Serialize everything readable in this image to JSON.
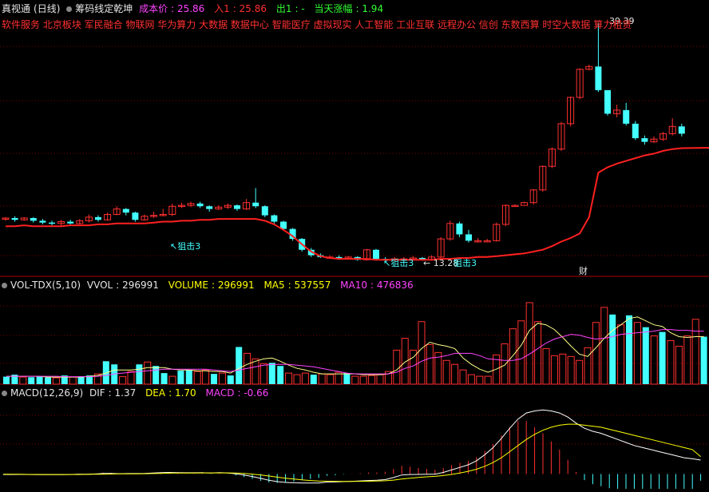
{
  "header": {
    "app": "真视通",
    "period": "(日线)",
    "indicator": "筹码线定乾坤",
    "cost_label": "成本价",
    "cost_value": "25.86",
    "in_label": "入1",
    "in_value": "25.86",
    "out_label": "出1",
    "out_value": "-",
    "chg_label": "当天涨幅",
    "chg_value": "1.94"
  },
  "concepts": "软件服务 北京板块 军民融合 物联网 华为算力 大数据 数据中心 智能医疗 虚拟现实 人工智能 工业互联 远程办公 信创 东数西算 时空大数据 算力租赁",
  "price_annotations": {
    "high": "39.39",
    "low": "13.28",
    "attack": "狙击3",
    "cai": "财"
  },
  "vol_header": {
    "name": "VOL-TDX(5,10)",
    "vvol_label": "VVOL",
    "vvol": "296991",
    "volume_label": "VOLUME",
    "volume": "296991",
    "ma5_label": "MA5",
    "ma5": "537557",
    "ma10_label": "MA10",
    "ma10": "476836"
  },
  "macd_header": {
    "name": "MACD(12,26,9)",
    "dif_label": "DIF",
    "dif": "1.37",
    "dea_label": "DEA",
    "dea": "1.70",
    "macd_label": "MACD",
    "macd": "-0.66"
  },
  "colors": {
    "up": "#ff3030",
    "down": "#44ffff",
    "cost_line": "#ff2020",
    "vol_ma5": "#ffff88",
    "vol_ma10": "#ff44ff",
    "dif": "#ffffff",
    "dea": "#ffff00",
    "grid": "#7a0000"
  },
  "chart_data": [
    {
      "type": "candlestick",
      "title": "筹码线定乾坤",
      "ylim": [
        12,
        40
      ],
      "candles": [
        [
          17.8,
          17.9,
          18.0,
          17.6
        ],
        [
          17.9,
          17.7,
          18.1,
          17.5
        ],
        [
          17.7,
          17.9,
          18.0,
          17.6
        ],
        [
          17.9,
          17.6,
          18.0,
          17.4
        ],
        [
          17.6,
          17.4,
          17.8,
          17.2
        ],
        [
          17.4,
          17.3,
          17.6,
          17.1
        ],
        [
          17.3,
          17.5,
          17.7,
          17.1
        ],
        [
          17.5,
          17.3,
          17.7,
          17.2
        ],
        [
          17.3,
          17.6,
          17.8,
          17.2
        ],
        [
          17.6,
          18.0,
          18.3,
          17.4
        ],
        [
          18.0,
          17.7,
          18.2,
          17.5
        ],
        [
          17.7,
          18.3,
          18.5,
          17.6
        ],
        [
          18.3,
          18.9,
          19.2,
          18.2
        ],
        [
          18.9,
          18.5,
          19.0,
          18.2
        ],
        [
          18.5,
          17.7,
          18.6,
          17.5
        ],
        [
          17.7,
          18.1,
          18.3,
          17.6
        ],
        [
          18.1,
          18.2,
          18.6,
          17.9
        ],
        [
          18.2,
          18.3,
          18.9,
          18.1
        ],
        [
          18.3,
          19.2,
          19.5,
          18.1
        ],
        [
          19.2,
          19.3,
          19.6,
          19.0
        ],
        [
          19.3,
          19.5,
          19.7,
          19.1
        ],
        [
          19.5,
          19.2,
          19.7,
          19.0
        ],
        [
          19.2,
          18.9,
          19.3,
          18.6
        ],
        [
          18.9,
          19.1,
          19.3,
          18.8
        ],
        [
          19.1,
          19.3,
          19.5,
          18.9
        ],
        [
          19.3,
          18.9,
          19.4,
          18.7
        ],
        [
          18.9,
          19.6,
          20.0,
          18.8
        ],
        [
          19.6,
          19.2,
          21.2,
          19.0
        ],
        [
          19.2,
          18.2,
          19.3,
          18.0
        ],
        [
          18.2,
          17.5,
          18.3,
          17.3
        ],
        [
          17.5,
          16.7,
          17.6,
          16.5
        ],
        [
          16.7,
          15.6,
          16.8,
          15.4
        ],
        [
          15.6,
          14.4,
          15.7,
          14.2
        ],
        [
          14.4,
          13.8,
          14.6,
          13.6
        ],
        [
          13.8,
          13.6,
          14.0,
          13.5
        ],
        [
          13.6,
          13.6,
          13.8,
          13.4
        ],
        [
          13.6,
          13.5,
          13.8,
          13.3
        ],
        [
          13.5,
          13.6,
          13.7,
          13.4
        ],
        [
          13.6,
          13.3,
          13.7,
          13.2
        ],
        [
          13.3,
          14.4,
          14.5,
          13.2
        ],
        [
          14.4,
          13.4,
          14.5,
          13.3
        ],
        [
          13.4,
          13.3,
          13.6,
          13.2
        ],
        [
          13.3,
          13.4,
          13.6,
          13.2
        ],
        [
          13.4,
          13.4,
          13.6,
          13.3
        ],
        [
          13.4,
          13.5,
          13.7,
          13.3
        ],
        [
          13.5,
          13.3,
          13.6,
          13.2
        ],
        [
          13.3,
          13.6,
          13.8,
          13.2
        ],
        [
          13.6,
          15.6,
          15.8,
          13.5
        ],
        [
          15.6,
          17.3,
          17.6,
          15.4
        ],
        [
          17.3,
          16.1,
          17.5,
          15.8
        ],
        [
          16.1,
          15.4,
          16.6,
          15.2
        ],
        [
          15.4,
          15.4,
          15.7,
          15.2
        ],
        [
          15.4,
          15.4,
          15.6,
          15.3
        ],
        [
          15.4,
          17.2,
          17.4,
          15.3
        ],
        [
          17.2,
          19.3,
          19.4,
          17.0
        ],
        [
          19.3,
          19.3,
          19.4,
          19.2
        ],
        [
          19.3,
          19.6,
          19.7,
          19.5
        ],
        [
          19.6,
          21.0,
          21.1,
          19.4
        ],
        [
          21.0,
          23.6,
          23.7,
          20.8
        ],
        [
          23.6,
          25.5,
          25.7,
          23.4
        ],
        [
          25.5,
          28.3,
          28.5,
          25.3
        ],
        [
          28.3,
          31.2,
          31.3,
          28.0
        ],
        [
          31.2,
          34.3,
          34.4,
          31.0
        ],
        [
          34.3,
          34.6,
          34.8,
          34.2
        ],
        [
          34.6,
          32.0,
          39.39,
          31.8
        ],
        [
          32.0,
          29.4,
          30.9,
          29.2
        ],
        [
          29.4,
          29.8,
          30.4,
          29.0
        ],
        [
          29.8,
          28.3,
          30.6,
          28.1
        ],
        [
          28.3,
          26.7,
          28.6,
          26.5
        ],
        [
          26.7,
          26.3,
          27.0,
          26.0
        ],
        [
          26.3,
          26.6,
          26.9,
          26.2
        ],
        [
          26.6,
          27.2,
          27.4,
          26.4
        ],
        [
          27.2,
          28.0,
          28.9,
          27.0
        ],
        [
          28.0,
          27.2,
          28.3,
          26.9
        ]
      ],
      "cost_line": [
        17.0,
        17.0,
        17.1,
        17.0,
        17.0,
        17.0,
        17.0,
        17.1,
        17.1,
        17.1,
        17.2,
        17.2,
        17.3,
        17.3,
        17.3,
        17.3,
        17.4,
        17.5,
        17.5,
        17.6,
        17.6,
        17.7,
        17.7,
        17.8,
        17.8,
        17.8,
        17.8,
        17.8,
        17.6,
        17.2,
        16.6,
        15.9,
        15.0,
        14.2,
        13.7,
        13.5,
        13.4,
        13.4,
        13.4,
        13.4,
        13.3,
        13.3,
        13.3,
        13.3,
        13.3,
        13.3,
        13.3,
        13.4,
        13.4,
        13.5,
        13.5,
        13.6,
        13.6,
        13.7,
        13.8,
        13.9,
        14.0,
        14.2,
        14.4,
        14.8,
        15.3,
        15.7,
        16.2,
        18.0,
        22.9,
        23.5,
        23.9,
        24.2,
        24.5,
        24.8,
        25.0,
        25.3,
        25.5,
        25.6
      ],
      "low_value": 13.28,
      "high_value": 39.39
    },
    {
      "type": "bar",
      "title": "VOL-TDX(5,10)",
      "values": [
        0.95,
        1.2,
        0.9,
        0.88,
        1.0,
        0.85,
        0.8,
        1.1,
        0.9,
        1.0,
        1.1,
        1.3,
        2.9,
        2.5,
        0.95,
        1.6,
        2.5,
        2.8,
        2.3,
        1.4,
        1.0,
        1.7,
        1.8,
        1.6,
        1.8,
        1.3,
        1.4,
        1.1,
        4.7,
        3.9,
        3.2,
        2.6,
        2.7,
        2.3,
        1.4,
        1.2,
        1.4,
        1.2,
        1.3,
        1.2,
        1.5,
        1.4,
        1.0,
        1.0,
        1.1,
        1.2,
        1.6,
        4.3,
        5.8,
        4.3,
        7.9,
        5.0,
        4.0,
        3.0,
        2.5,
        1.8,
        1.2,
        1.0,
        1.0,
        3.7,
        5.1,
        7.0,
        8.0,
        10.3,
        7.9,
        4.5,
        3.6,
        3.8,
        3.5,
        3.0,
        4.6,
        7.8,
        9.7,
        8.8,
        7.5,
        8.7,
        7.8,
        7.2,
        6.1,
        6.6,
        5.5,
        4.8,
        6.1,
        8.2,
        6.0
      ],
      "ma5": [
        1.0,
        1.0,
        1.0,
        1.0,
        1.0,
        0.9,
        0.9,
        0.9,
        0.9,
        0.9,
        1.0,
        1.1,
        1.4,
        1.8,
        1.8,
        1.8,
        1.9,
        2.1,
        2.1,
        2.1,
        1.9,
        1.8,
        1.8,
        1.7,
        1.7,
        1.6,
        1.6,
        1.4,
        2.0,
        2.5,
        2.9,
        3.2,
        3.3,
        2.9,
        2.4,
        2.0,
        1.8,
        1.5,
        1.3,
        1.3,
        1.3,
        1.3,
        1.3,
        1.2,
        1.2,
        1.2,
        1.3,
        1.8,
        2.8,
        3.4,
        4.5,
        5.3,
        5.0,
        4.8,
        4.5,
        3.3,
        2.5,
        1.9,
        1.5,
        1.9,
        2.4,
        3.6,
        4.9,
        6.8,
        7.7,
        7.5,
        6.9,
        5.9,
        4.8,
        3.8,
        3.5,
        4.6,
        5.8,
        6.8,
        7.5,
        8.3,
        8.5,
        8.0,
        7.5,
        7.3,
        6.5,
        6.0,
        5.9,
        6.0,
        6.0
      ],
      "ma10": [
        1.0,
        1.0,
        1.0,
        1.0,
        1.0,
        1.0,
        1.0,
        0.95,
        0.95,
        0.95,
        0.95,
        1.0,
        1.1,
        1.3,
        1.4,
        1.5,
        1.6,
        1.7,
        1.8,
        1.9,
        1.9,
        1.9,
        1.9,
        1.9,
        1.9,
        1.8,
        1.7,
        1.6,
        1.8,
        2.0,
        2.2,
        2.4,
        2.5,
        2.5,
        2.5,
        2.4,
        2.3,
        2.2,
        2.0,
        1.8,
        1.6,
        1.4,
        1.3,
        1.3,
        1.3,
        1.3,
        1.3,
        1.5,
        2.0,
        2.3,
        2.9,
        3.3,
        3.4,
        3.6,
        3.9,
        3.9,
        3.9,
        3.6,
        3.2,
        3.1,
        3.0,
        3.0,
        3.2,
        3.8,
        4.5,
        5.2,
        5.7,
        6.0,
        6.3,
        6.2,
        5.9,
        5.7,
        5.8,
        6.0,
        6.3,
        6.4,
        6.5,
        6.6,
        6.7,
        6.9,
        6.9,
        6.8,
        6.8,
        6.7,
        6.7
      ],
      "up": [
        0,
        0,
        1,
        0,
        0,
        0,
        1,
        0,
        1,
        0,
        0,
        1,
        0,
        0,
        1,
        1,
        0,
        1,
        0,
        0,
        1,
        0,
        0,
        1,
        1,
        0,
        1,
        0,
        0,
        1,
        1,
        1,
        0,
        0,
        1,
        1,
        1,
        0,
        1,
        1,
        1,
        0,
        1,
        1,
        1,
        1,
        1,
        1,
        1,
        1,
        1,
        1,
        1,
        1,
        1,
        1,
        1,
        1,
        1,
        1,
        1,
        1,
        1,
        1,
        1,
        1,
        1,
        1,
        1,
        1,
        1,
        1,
        1,
        0,
        1,
        0,
        1,
        0,
        1,
        0,
        1,
        1,
        1,
        1,
        0
      ]
    },
    {
      "type": "line",
      "title": "MACD(12,26,9)",
      "dif": [
        -0.05,
        -0.05,
        -0.04,
        -0.05,
        -0.06,
        -0.07,
        -0.06,
        -0.06,
        -0.05,
        -0.03,
        -0.03,
        0.0,
        0.05,
        0.06,
        0.03,
        0.04,
        0.04,
        0.05,
        0.1,
        0.13,
        0.15,
        0.14,
        0.12,
        0.12,
        0.13,
        0.1,
        0.13,
        0.11,
        0.02,
        -0.1,
        -0.25,
        -0.43,
        -0.62,
        -0.75,
        -0.83,
        -0.87,
        -0.88,
        -0.88,
        -0.88,
        -0.8,
        -0.78,
        -0.75,
        -0.72,
        -0.68,
        -0.64,
        -0.62,
        -0.55,
        -0.35,
        -0.1,
        -0.05,
        -0.04,
        -0.03,
        -0.02,
        0.15,
        0.4,
        0.65,
        0.9,
        1.3,
        1.9,
        2.6,
        3.5,
        4.5,
        5.4,
        6.0,
        6.2,
        6.3,
        6.2,
        6.0,
        5.6,
        5.0,
        4.5,
        4.2,
        4.0,
        3.7,
        3.4,
        3.1,
        2.8,
        2.6,
        2.4,
        2.2,
        2.0,
        1.8,
        1.6,
        1.5,
        1.37
      ],
      "dea": [
        -0.03,
        -0.03,
        -0.03,
        -0.04,
        -0.04,
        -0.05,
        -0.05,
        -0.05,
        -0.05,
        -0.05,
        -0.04,
        -0.03,
        -0.02,
        0.0,
        0.01,
        0.02,
        0.02,
        0.03,
        0.04,
        0.06,
        0.08,
        0.09,
        0.1,
        0.1,
        0.11,
        0.11,
        0.11,
        0.11,
        0.09,
        0.05,
        -0.01,
        -0.09,
        -0.2,
        -0.31,
        -0.41,
        -0.5,
        -0.58,
        -0.64,
        -0.69,
        -0.71,
        -0.72,
        -0.73,
        -0.73,
        -0.72,
        -0.71,
        -0.69,
        -0.66,
        -0.6,
        -0.5,
        -0.41,
        -0.34,
        -0.28,
        -0.23,
        -0.15,
        -0.04,
        0.1,
        0.26,
        0.47,
        0.76,
        1.13,
        1.6,
        2.2,
        2.8,
        3.4,
        3.9,
        4.3,
        4.6,
        4.8,
        4.9,
        4.9,
        4.8,
        4.7,
        4.6,
        4.4,
        4.2,
        4.0,
        3.8,
        3.6,
        3.4,
        3.2,
        3.0,
        2.8,
        2.6,
        2.4,
        1.7
      ],
      "ylim": [
        -1.3,
        7.5
      ]
    }
  ]
}
